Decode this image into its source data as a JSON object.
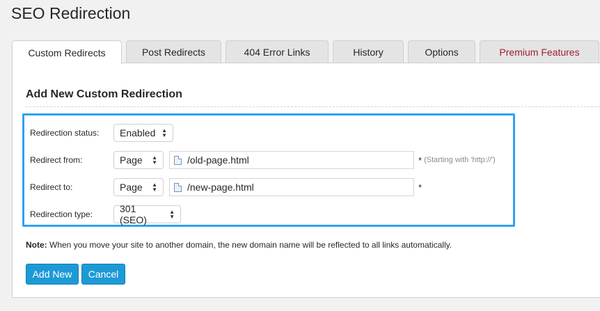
{
  "page": {
    "title": "SEO Redirection"
  },
  "tabs": [
    {
      "label": "Custom Redirects",
      "active": true
    },
    {
      "label": "Post Redirects"
    },
    {
      "label": "404 Error Links"
    },
    {
      "label": "History"
    },
    {
      "label": "Options"
    },
    {
      "label": "Premium Features",
      "color": "#a0202f"
    }
  ],
  "form": {
    "title": "Add New Custom Redirection",
    "status": {
      "label": "Redirection status:",
      "value": "Enabled"
    },
    "from": {
      "label": "Redirect from:",
      "type": "Page",
      "value": "/old-page.html",
      "required": "*",
      "hint": "(Starting with 'http://')"
    },
    "to": {
      "label": "Redirect to:",
      "type": "Page",
      "value": "/new-page.html",
      "required": "*"
    },
    "redirect_type": {
      "label": "Redirection type:",
      "value": "301 (SEO)"
    },
    "highlight_color": "#2ea2f2"
  },
  "note": {
    "prefix": "Note:",
    "text": " When you move your site to another domain, the new domain name will be reflected to all links automatically."
  },
  "buttons": {
    "add": "Add New",
    "cancel": "Cancel",
    "color": "#1d9ad6"
  }
}
